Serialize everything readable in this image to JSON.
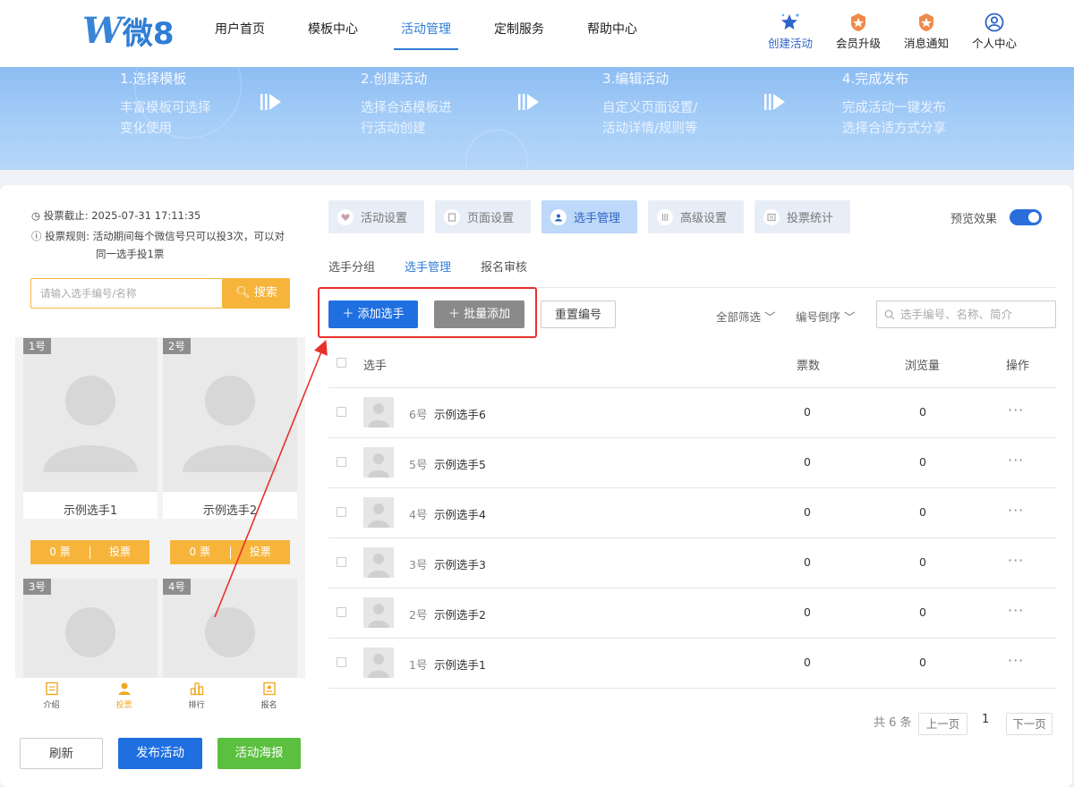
{
  "header": {
    "logo_mark": "W",
    "logo_text": "微8",
    "nav": [
      "用户首页",
      "模板中心",
      "活动管理",
      "定制服务",
      "帮助中心"
    ],
    "nav_active": "活动管理",
    "icons": [
      {
        "label": "创建活动",
        "icon": "star-icon"
      },
      {
        "label": "会员升级",
        "icon": "member-badge-icon"
      },
      {
        "label": "消息通知",
        "icon": "notification-badge-icon"
      },
      {
        "label": "个人中心",
        "icon": "user-icon"
      }
    ]
  },
  "banner": {
    "steps": [
      {
        "title": "1.选择模板",
        "desc1": "丰富模板可选择",
        "desc2": "变化使用"
      },
      {
        "title": "2.创建活动",
        "desc1": "选择合适模板进",
        "desc2": "行活动创建"
      },
      {
        "title": "3.编辑活动",
        "desc1": "自定义页面设置/",
        "desc2": "活动详情/规则等"
      },
      {
        "title": "4.完成发布",
        "desc1": "完成活动一键发布",
        "desc2": "选择合适方式分享"
      }
    ]
  },
  "preview": {
    "deadline_label": "投票截止:",
    "deadline_value": "2025-07-31 17:11:35",
    "rule_label": "投票规则:",
    "rule_text1": "活动期间每个微信号只可以投3次，可以对",
    "rule_text2": "同一选手投1票",
    "search_placeholder": "请输入选手编号/名称",
    "search_button": "搜索",
    "cards": [
      {
        "no": "1号",
        "name": "示例选手1",
        "votes": "0 票",
        "vote_btn": "投票"
      },
      {
        "no": "2号",
        "name": "示例选手2",
        "votes": "0 票",
        "vote_btn": "投票"
      },
      {
        "no": "3号"
      },
      {
        "no": "4号"
      }
    ],
    "tabs": [
      "介绍",
      "投票",
      "排行",
      "报名"
    ],
    "tab_active": "投票"
  },
  "bottom_buttons": {
    "refresh": "刷新",
    "publish": "发布活动",
    "poster": "活动海报"
  },
  "main": {
    "tabs": [
      "活动设置",
      "页面设置",
      "选手管理",
      "高级设置",
      "投票统计"
    ],
    "tab_active": "选手管理",
    "preview_label": "预览效果",
    "preview_toggle": true,
    "subtabs": [
      "选手分组",
      "选手管理",
      "报名审核"
    ],
    "subtab_active": "选手管理",
    "toolbar": {
      "add": "添加选手",
      "batch_add": "批量添加",
      "reset_no": "重置编号",
      "filter_all": "全部筛选",
      "sort": "编号倒序",
      "search_placeholder": "选手编号、名称、简介"
    },
    "table": {
      "headers": {
        "player": "选手",
        "votes": "票数",
        "views": "浏览量",
        "action": "操作"
      },
      "rows": [
        {
          "no": "6号",
          "name": "示例选手6",
          "votes": "0",
          "views": "0"
        },
        {
          "no": "5号",
          "name": "示例选手5",
          "votes": "0",
          "views": "0"
        },
        {
          "no": "4号",
          "name": "示例选手4",
          "votes": "0",
          "views": "0"
        },
        {
          "no": "3号",
          "name": "示例选手3",
          "votes": "0",
          "views": "0"
        },
        {
          "no": "2号",
          "name": "示例选手2",
          "votes": "0",
          "views": "0"
        },
        {
          "no": "1号",
          "name": "示例选手1",
          "votes": "0",
          "views": "0"
        }
      ],
      "more": "···"
    },
    "pagination": {
      "total": "共 6 条",
      "prev": "上一页",
      "current": "1",
      "next": "下一页"
    }
  },
  "colors": {
    "primary": "#2a6edb",
    "accent": "#f6b43a",
    "green": "#5bbf3f",
    "highlight": "#e8302a"
  }
}
